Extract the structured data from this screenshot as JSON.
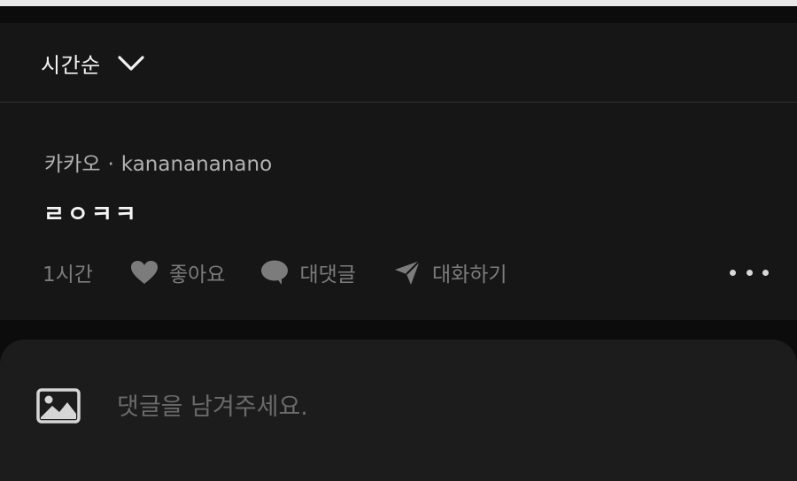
{
  "sort": {
    "label": "시간순",
    "icon": "chevron-down-icon"
  },
  "comment": {
    "author": "카카오",
    "separator": "·",
    "username": "kananananano",
    "text": "ㄹㅇㅋㅋ",
    "time": "1시간",
    "like_label": "좋아요",
    "reply_label": "대댓글",
    "conversation_label": "대화하기",
    "icons": [
      "heart-icon",
      "chat-bubble-icon",
      "send-icon",
      "more-dots-icon"
    ]
  },
  "composer": {
    "placeholder": "댓글을 남겨주세요.",
    "image_icon": "image-icon"
  },
  "colors": {
    "background": "#161616",
    "muted_text": "#7c7c7c",
    "primary_text": "#f5f5f5"
  }
}
